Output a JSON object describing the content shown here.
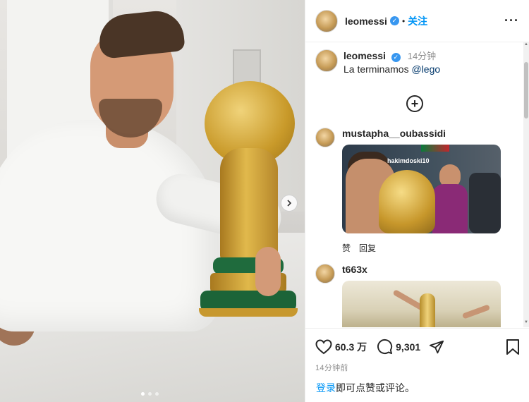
{
  "post": {
    "author": "leomessi",
    "follow_label": "关注",
    "more_label": "···",
    "caption_text": "La terminamos",
    "caption_mention": "@lego",
    "caption_time": "14分钟",
    "add_comment_symbol": "+"
  },
  "comments": [
    {
      "user": "mustapha__oubassidi",
      "image_watermark": "hakimdoski10",
      "actions": [
        "赞",
        "回复"
      ]
    },
    {
      "user": "t663x"
    }
  ],
  "stats": {
    "likes": "60.3 万",
    "comments": "9,301"
  },
  "time_ago": "14分钟前",
  "login_prompt": {
    "link": "登录",
    "rest": "即可点赞或评论。"
  },
  "icons": {
    "verified": "verified-badge-icon",
    "next": "chevron-right-icon",
    "like": "heart-icon",
    "comment": "comment-bubble-icon",
    "share": "send-icon",
    "save": "bookmark-icon",
    "add": "plus-circle-icon"
  },
  "carousel": {
    "slide_count": 3,
    "active_index": 0
  },
  "colors": {
    "link_blue": "#0095f6",
    "verified_blue": "#3897f0",
    "mention": "#00376b",
    "muted": "#8e8e8e"
  }
}
